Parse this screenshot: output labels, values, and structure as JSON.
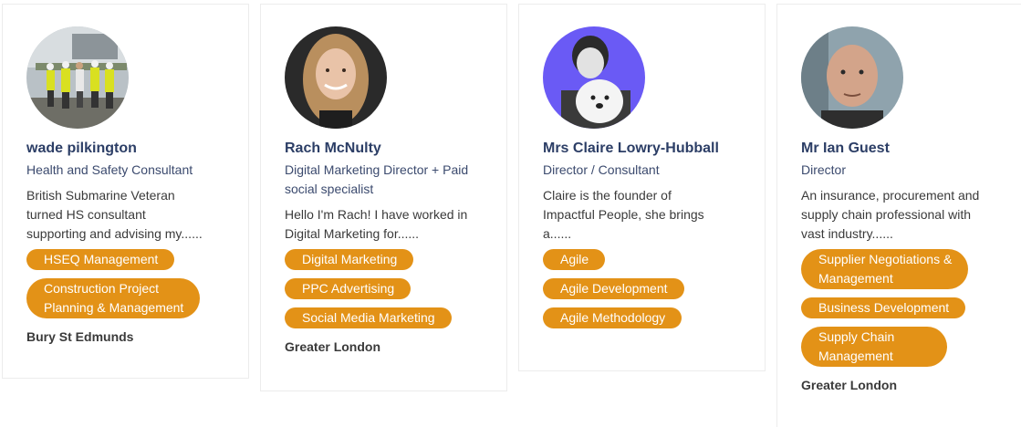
{
  "profiles": [
    {
      "name": "wade pilkington",
      "role": "Health and Safety Consultant",
      "bio": [
        "British Submarine Veteran",
        "turned HS consultant",
        "supporting and advising my......"
      ],
      "tags": [
        [
          "HSEQ Management"
        ],
        [
          "Construction Project",
          "Planning & Management"
        ]
      ],
      "location": "Bury St Edmunds"
    },
    {
      "name": "Rach McNulty",
      "role": [
        "Digital Marketing Director + Paid",
        "social specialist"
      ],
      "bio": [
        "Hello I'm Rach! I have worked in",
        "Digital Marketing for......"
      ],
      "tags": [
        [
          "Digital Marketing"
        ],
        [
          "PPC Advertising"
        ],
        [
          "Social Media Marketing"
        ]
      ],
      "location": "Greater London"
    },
    {
      "name": "Mrs Claire Lowry-Hubball",
      "role": "Director / Consultant",
      "bio": [
        "Claire is the founder of",
        "Impactful People, she brings",
        "a......"
      ],
      "tags": [
        [
          "Agile"
        ],
        [
          "Agile Development"
        ],
        [
          "Agile Methodology"
        ]
      ],
      "location": ""
    },
    {
      "name": "Mr Ian Guest",
      "role": "Director",
      "bio": [
        "An insurance, procurement and",
        "supply chain professional with",
        "vast industry......"
      ],
      "tags": [
        [
          "Supplier Negotiations &",
          "Management"
        ],
        [
          "Business Development"
        ],
        [
          "Supply Chain",
          "Management"
        ]
      ],
      "location": "Greater London"
    }
  ],
  "colors": {
    "accent": "#e39217",
    "name": "#2c3e66",
    "card_border": "#ececec"
  }
}
